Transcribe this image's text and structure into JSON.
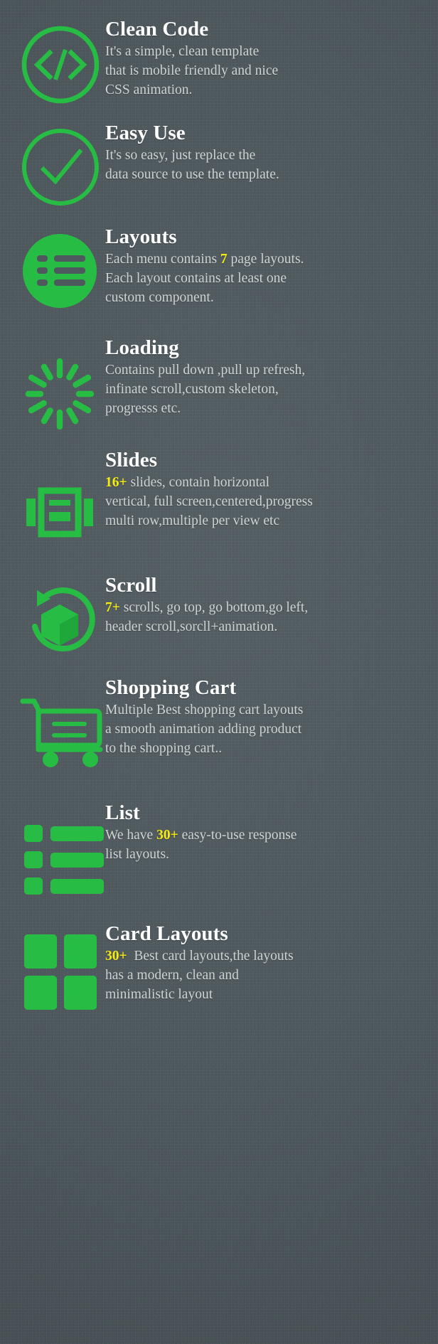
{
  "theme": {
    "background_color": "#4e595e",
    "accent_green": "#27bd45",
    "title_color": "#ffffff",
    "body_color": "#cfd4d3",
    "highlight_color": "#f7ec0f"
  },
  "features": [
    {
      "icon": "code-circle-icon",
      "title": "Clean Code",
      "highlight": "",
      "desc": "It's a simple, clean template that is mobile friendly and nice CSS animation.",
      "desc_lines": [
        "It's a simple, clean template",
        "that is mobile friendly and nice",
        "CSS animation."
      ]
    },
    {
      "icon": "check-circle-icon",
      "title": "Easy Use",
      "highlight": "",
      "desc": "It's so easy, just replace the data source to use the template.",
      "desc_lines": [
        "It's so easy, just replace the",
        "data source to use the template."
      ]
    },
    {
      "icon": "list-circle-icon",
      "title": "Layouts",
      "highlight": "7",
      "desc": "Each menu contains 7 page layouts. Each layout contains at least one custom component.",
      "desc_lines": [
        "Each menu contains 7 page layouts.",
        "Each layout contains at least one",
        "custom component."
      ]
    },
    {
      "icon": "loading-spinner-icon",
      "title": "Loading",
      "highlight": "",
      "desc": "Contains pull down ,pull up refresh, infinate scroll,custom skeleton, progresss etc.",
      "desc_lines": [
        "Contains pull down ,pull up refresh,",
        "infinate scroll,custom skeleton,",
        "progresss etc."
      ]
    },
    {
      "icon": "carousel-slides-icon",
      "title": "Slides",
      "highlight": "16+",
      "desc": "16+ slides, contain horizontal vertical, full screen,centered,progress multi row,multiple per view etc",
      "desc_lines": [
        "16+ slides, contain horizontal",
        "vertical, full screen,centered,progress",
        "multi row,multiple per view etc"
      ]
    },
    {
      "icon": "scroll-refresh-cube-icon",
      "title": "Scroll",
      "highlight": "7+",
      "desc": "7+ scrolls, go top, go bottom,go left, header scroll,sorcll+animation.",
      "desc_lines": [
        "7+ scrolls, go top, go bottom,go left,",
        "header scroll,sorcll+animation."
      ]
    },
    {
      "icon": "shopping-cart-icon",
      "title": "Shopping Cart",
      "highlight": "",
      "desc": "Multiple Best shopping cart layouts a smooth animation adding product to the shopping cart..",
      "desc_lines": [
        "Multiple Best shopping cart layouts",
        "a smooth animation adding product",
        "to the shopping cart.."
      ]
    },
    {
      "icon": "list-bars-icon",
      "title": "List",
      "highlight": "30+",
      "desc": "We have 30+ easy-to-use response list layouts.",
      "desc_lines": [
        "We have 30+ easy-to-use response",
        "list layouts."
      ]
    },
    {
      "icon": "card-grid-icon",
      "title": "Card Layouts",
      "highlight": "30+",
      "desc": "30+  Best card layouts,the layouts has a modern, clean and minimalistic layout",
      "desc_lines": [
        "30+  Best card layouts,the layouts",
        "has a modern, clean and",
        "minimalistic layout"
      ]
    }
  ]
}
